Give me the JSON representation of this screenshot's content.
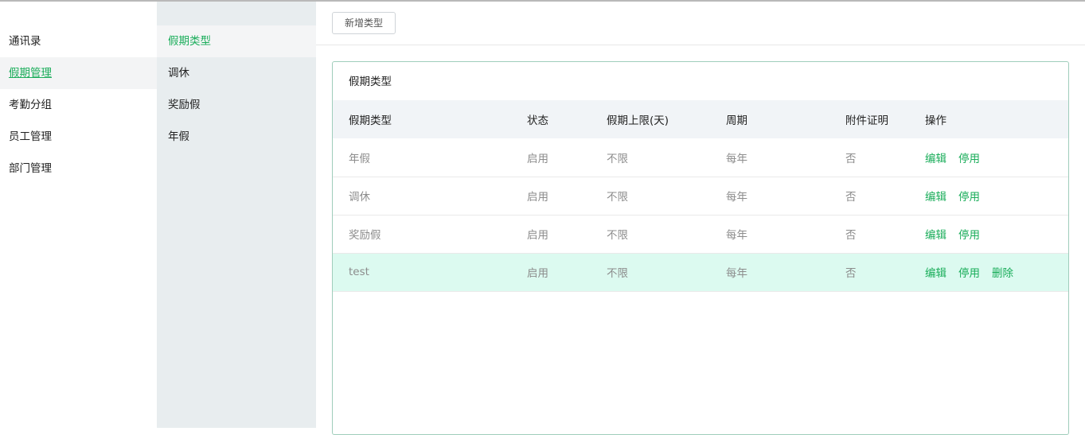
{
  "nav": {
    "items": [
      {
        "label": "通讯录"
      },
      {
        "label": "假期管理"
      },
      {
        "label": "考勤分组"
      },
      {
        "label": "员工管理"
      },
      {
        "label": "部门管理"
      }
    ]
  },
  "subnav": {
    "items": [
      {
        "label": "假期类型"
      },
      {
        "label": "调休"
      },
      {
        "label": "奖励假"
      },
      {
        "label": "年假"
      }
    ]
  },
  "toolbar": {
    "add_label": "新增类型"
  },
  "panel": {
    "title": "假期类型",
    "columns": [
      "假期类型",
      "状态",
      "假期上限(天)",
      "周期",
      "附件证明",
      "操作"
    ],
    "rows": [
      {
        "name": "年假",
        "status": "启用",
        "limit": "不限",
        "period": "每年",
        "attachment": "否",
        "edit": "编辑",
        "disable": "停用"
      },
      {
        "name": "调休",
        "status": "启用",
        "limit": "不限",
        "period": "每年",
        "attachment": "否",
        "edit": "编辑",
        "disable": "停用"
      },
      {
        "name": "奖励假",
        "status": "启用",
        "limit": "不限",
        "period": "每年",
        "attachment": "否",
        "edit": "编辑",
        "disable": "停用"
      },
      {
        "name": "test",
        "status": "启用",
        "limit": "不限",
        "period": "每年",
        "attachment": "否",
        "edit": "编辑",
        "disable": "停用",
        "delete": "删除"
      }
    ]
  },
  "colors": {
    "accent": "#1aad5a",
    "highlight_row": "#dcfaf0",
    "subnav_bg": "#e8edef",
    "header_bg": "#f1f4f7"
  }
}
